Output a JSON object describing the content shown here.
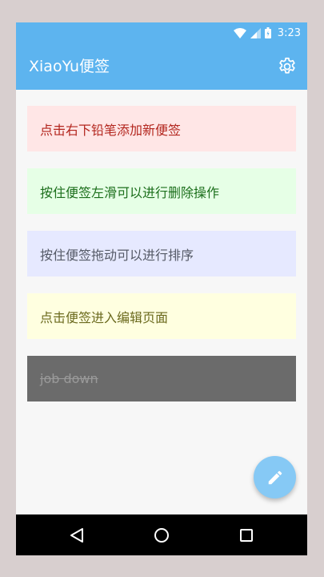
{
  "status_bar": {
    "time": "3:23",
    "icons": [
      "wifi-icon",
      "signal-icon",
      "battery-icon"
    ]
  },
  "app_bar": {
    "title": "XiaoYu便签",
    "settings_icon": "gear-icon"
  },
  "notes": [
    {
      "text": "点击右下铅笔添加新便签",
      "bg": "#ffe6e6",
      "color": "#b3261e",
      "done": false
    },
    {
      "text": "按住便签左滑可以进行删除操作",
      "bg": "#e6ffe6",
      "color": "#1b6e1b",
      "done": false
    },
    {
      "text": "按住便签拖动可以进行排序",
      "bg": "#e6e9ff",
      "color": "#555a66",
      "done": false
    },
    {
      "text": "点击便签进入编辑页面",
      "bg": "#ffffe0",
      "color": "#6b6a1e",
      "done": false
    },
    {
      "text": "job down",
      "bg": "#6b6b6b",
      "color": "#9a9a9a",
      "done": true
    }
  ],
  "fab": {
    "icon": "pencil-icon"
  },
  "nav_bar": {
    "icons": [
      "back-icon",
      "home-icon",
      "recents-icon"
    ]
  },
  "colors": {
    "primary": "#5db4ef",
    "fab": "#86c9f5"
  }
}
